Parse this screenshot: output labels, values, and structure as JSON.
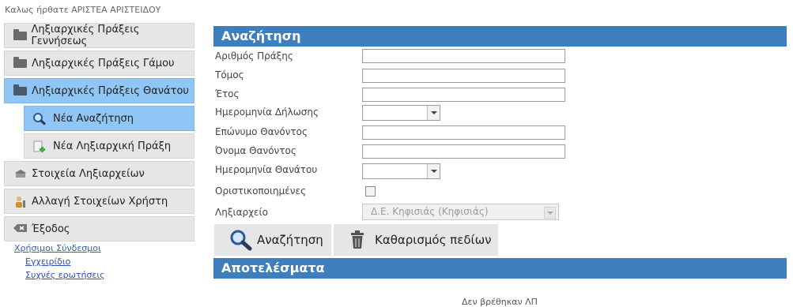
{
  "welcome": "Καλως ήρθατε ΑΡΙΣΤΕΑ ΑΡΙΣΤΕΙΔΟΥ",
  "sidebar": {
    "items": [
      {
        "label": "Ληξιαρχικές Πράξεις Γεννήσεως",
        "icon": "folder-icon"
      },
      {
        "label": "Ληξιαρχικές Πράξεις Γάμου",
        "icon": "folder-icon"
      },
      {
        "label": "Ληξιαρχικές Πράξεις Θανάτου",
        "icon": "folder-open-icon"
      },
      {
        "label": "Νέα Αναζήτηση",
        "icon": "search-icon"
      },
      {
        "label": "Νέα Ληξιαρχική Πράξη",
        "icon": "new-document-icon"
      },
      {
        "label": "Στοιχεία Ληξιαρχείων",
        "icon": "registry-icon"
      },
      {
        "label": "Αλλαγή Στοιχείων Χρήστη",
        "icon": "user-edit-icon"
      },
      {
        "label": "Έξοδος",
        "icon": "logout-icon"
      }
    ]
  },
  "links": {
    "heading": "Χρήσιμοι Σύνδεσμοι",
    "manual": "Εγχειρίδιο",
    "faq": "Συχνές ερωτήσεις"
  },
  "search": {
    "title": "Αναζήτηση",
    "fields": {
      "act_number": {
        "label": "Αριθμός Πράξης",
        "value": ""
      },
      "volume": {
        "label": "Τόμος",
        "value": ""
      },
      "year": {
        "label": "Έτος",
        "value": ""
      },
      "declaration_date": {
        "label": "Ημερομηνία Δήλωσης",
        "value": ""
      },
      "deceased_surname": {
        "label": "Επώνυμο Θανόντος",
        "value": ""
      },
      "deceased_name": {
        "label": "Όνομα Θανόντος",
        "value": ""
      },
      "death_date": {
        "label": "Ημερομηνία Θανάτου",
        "value": ""
      },
      "finalized": {
        "label": "Οριστικοποιημένες"
      },
      "registry": {
        "label": "Ληξιαρχείο",
        "value": "Δ.Ε. Κηφισιάς (Κηφισιάς)"
      }
    },
    "buttons": {
      "search": "Αναζήτηση",
      "clear": "Καθαρισμός πεδίων"
    }
  },
  "results": {
    "title": "Αποτελέσματα",
    "empty_text": "Δεν βρέθηκαν ΛΠ"
  },
  "colors": {
    "accent": "#3f7ebd",
    "sidebar_active": "#8fc6f5"
  }
}
